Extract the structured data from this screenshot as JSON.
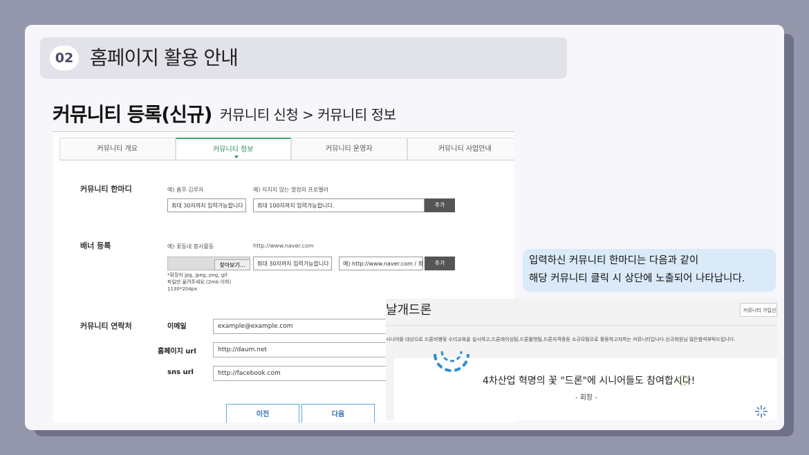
{
  "section": {
    "number": "02",
    "title": "홈페이지 활용 안내"
  },
  "page": {
    "heading": "커뮤니티 등록(신규)",
    "subheading": "커뮤니티 신청 > 커뮤니티 정보"
  },
  "form": {
    "tabs": [
      {
        "label": "커뮤니티 개요",
        "active": false
      },
      {
        "label": "커뮤니티 정보",
        "active": true
      },
      {
        "label": "커뮤니티 운영자",
        "active": false
      },
      {
        "label": "커뮤니티 사업안내",
        "active": false
      }
    ],
    "motto": {
      "label": "커뮤니티 한마디",
      "hint1": "예) 홈푸 김루자",
      "hint2": "예) 지치지 않는 열정의 프로펠러",
      "input1": "최대 30자까지 입력가능합니다",
      "input2": "최대 100자까지 입력가능합니다.",
      "add": "추가"
    },
    "banner": {
      "label": "배너 등록",
      "hint1": "예) 꽃동네 봉사활동",
      "hint2": "http://www.naver.com",
      "find": "찾아보기...",
      "input1": "최대 30자까지 입력가능합니다",
      "input2": "예) http://www.naver.com / 최",
      "add": "추가",
      "note1": "*확장자 jpg, jpeg, png, gif",
      "note2": "파일만 올려주세요.(2mb 이하)",
      "note3": "1130*204px"
    },
    "contact": {
      "label": "커뮤니티 연락처",
      "email_label": "이메일",
      "email_value": "example@example.com",
      "homepage_label": "홈페이지 url",
      "homepage_value": "http://daum.net",
      "sns_label": "sns url",
      "sns_value": "http://facebook.com"
    },
    "prev": "이전",
    "next": "다음"
  },
  "callout": {
    "line1": "입력하신 커뮤니티 한마디는 다음과 같이",
    "line2": "해당 커뮤니티 클릭 시 상단에 노출되어 나타납니다."
  },
  "preview": {
    "title": "날개드론",
    "join_button": "커뮤니티 가입신청",
    "description": "시니어를 대상으로 드론비행및 수리교육을 실시하고,드론레이싱팀,드론촬영팀,드론자격증등 소규모팀으로 활동하고자하는 커뮤니티입니다.신규회원님 많은참석부탁드립니다.",
    "headline": "4차산업 혁명의 꽃 \"드론\"에 시니어들도 참여합시다!",
    "sub": "- 회장 -"
  },
  "colors": {
    "accent_green": "#2b8f5c",
    "accent_blue": "#58a7d8",
    "callout_bg": "#daeaf8"
  }
}
